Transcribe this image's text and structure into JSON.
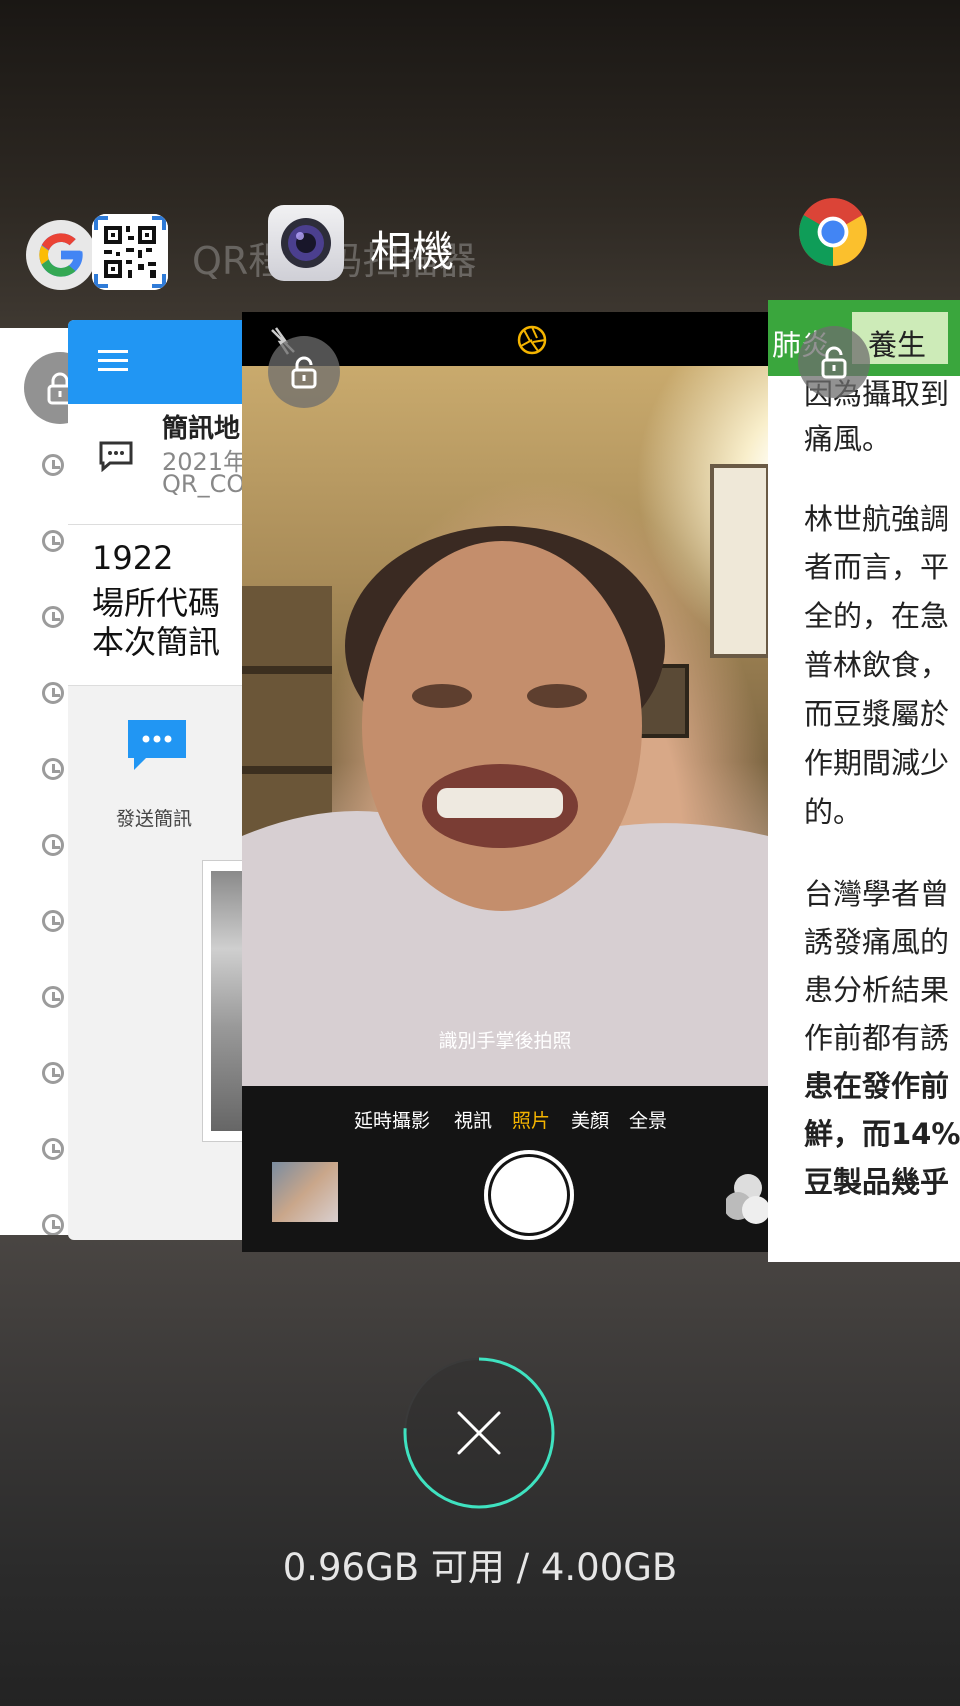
{
  "apps": {
    "qr_label": "QR程式码扫描器",
    "camera_label": "相機"
  },
  "sms_card": {
    "title": "簡訊地",
    "date": "2021年",
    "tag": "QR_CO",
    "lines": [
      "1922",
      "場所代碼",
      "本次簡訊"
    ],
    "send_label": "發送簡訊"
  },
  "camera_card": {
    "hint": "識別手掌後拍照",
    "modes": [
      "延時攝影",
      "視訊",
      "照片",
      "美顏",
      "全景"
    ],
    "active_mode": "照片"
  },
  "article_card": {
    "tabs": [
      "肺炎",
      "養生"
    ],
    "lines": [
      {
        "text": "因為攝取到",
        "bold": false
      },
      {
        "text": "痛風。",
        "bold": false
      },
      {
        "text": "林世航強調",
        "bold": false
      },
      {
        "text": "者而言，平",
        "bold": false
      },
      {
        "text": "全的，在急",
        "bold": false
      },
      {
        "text": "普林飲食，",
        "bold": false
      },
      {
        "text": "而豆漿屬於",
        "bold": false
      },
      {
        "text": "作期間減少",
        "bold": false
      },
      {
        "text": "的。",
        "bold": false
      },
      {
        "text": "台灣學者曾",
        "bold": false
      },
      {
        "text": "誘發痛風的",
        "bold": false
      },
      {
        "text": "患分析結果",
        "bold": false
      },
      {
        "text": "作前都有誘",
        "bold": false
      },
      {
        "text": "患在發作前",
        "bold": true
      },
      {
        "text": "鮮，而14%",
        "bold": true
      },
      {
        "text": "豆製品幾乎",
        "bold": true
      }
    ]
  },
  "memory": {
    "text": "0.96GB 可用 / 4.00GB",
    "available_gb": 0.96,
    "total_gb": 4.0
  },
  "colors": {
    "accent_ring": "#3fe2c0",
    "sms_bar": "#2196f3",
    "article_tab": "#3aa63d",
    "active_mode": "#f4b400"
  }
}
